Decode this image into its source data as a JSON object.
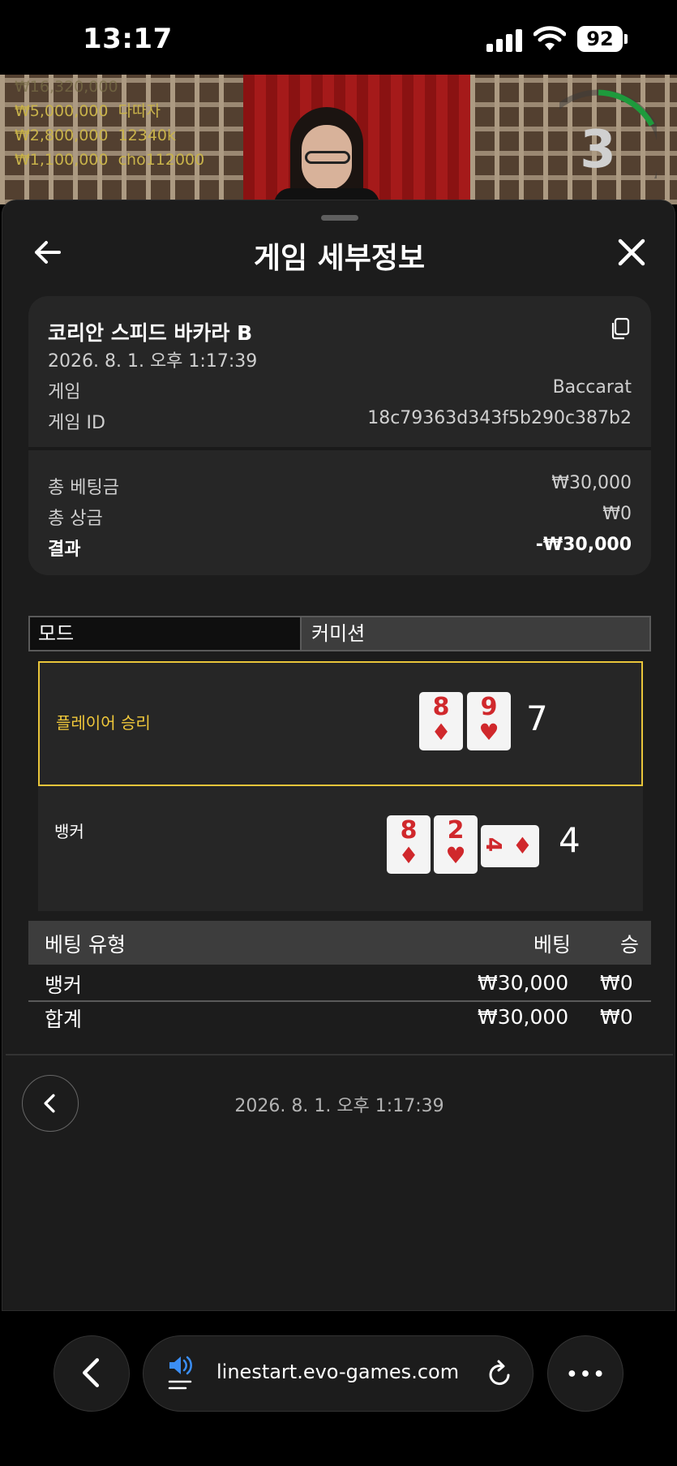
{
  "status": {
    "time": "13:17",
    "battery": "92"
  },
  "video": {
    "winners": [
      {
        "amount": "₩16,320,000",
        "name": ""
      },
      {
        "amount": "₩5,000,000",
        "name": "다따자"
      },
      {
        "amount": "₩2,800,000",
        "name": "12340k"
      },
      {
        "amount": "₩1,100,000",
        "name": "cho112000"
      }
    ],
    "countdown": "3"
  },
  "header": {
    "title": "게임 세부정보"
  },
  "info": {
    "table_name": "코리안 스피드 바카라 B",
    "datetime": "2026. 8. 1. 오후 1:17:39",
    "game_label": "게임",
    "game_value": "Baccarat",
    "game_id_label": "게임 ID",
    "game_id_value": "18c79363d343f5b290c387b2",
    "total_bet_label": "총 베팅금",
    "total_bet_value": "₩30,000",
    "total_win_label": "총 상금",
    "total_win_value": "₩0",
    "result_label": "결과",
    "result_value": "-₩30,000"
  },
  "mode_bar": {
    "mode": "모드",
    "commission": "커미션"
  },
  "hands": {
    "player": {
      "label": "플레이어 승리",
      "score": "7",
      "cards": [
        {
          "rank": "8",
          "suit": "♦"
        },
        {
          "rank": "9",
          "suit": "♥"
        }
      ]
    },
    "banker": {
      "label": "뱅커",
      "score": "4",
      "cards": [
        {
          "rank": "8",
          "suit": "♦"
        },
        {
          "rank": "2",
          "suit": "♥"
        },
        {
          "rank": "4",
          "suit": "♦"
        }
      ]
    }
  },
  "bets": {
    "headers": {
      "type": "베팅 유형",
      "bet": "베팅",
      "win": "승"
    },
    "rows": [
      {
        "type": "뱅커",
        "bet": "₩30,000",
        "win": "₩0"
      }
    ],
    "total": {
      "type": "합계",
      "bet": "₩30,000",
      "win": "₩0"
    }
  },
  "footer": {
    "datetime": "2026. 8. 1. 오후 1:17:39"
  },
  "browser": {
    "url": "linestart.evo-games.com"
  },
  "colors": {
    "win_highlight": "#e9c53a",
    "red_suit": "#d0282c",
    "sheet_bg": "#1c1c1c",
    "card_bg": "#262626"
  }
}
